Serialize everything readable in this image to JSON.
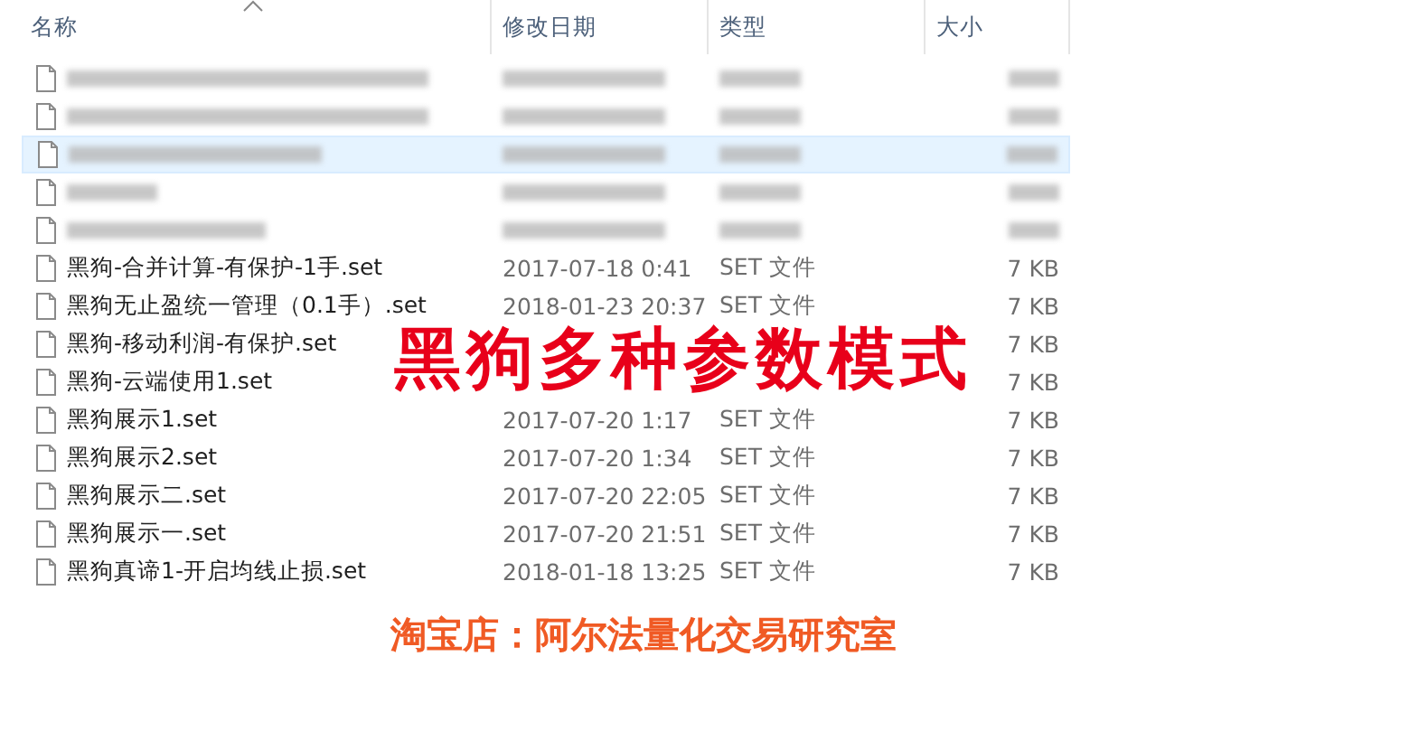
{
  "columns": [
    {
      "label": "名称",
      "sorted": true
    },
    {
      "label": "修改日期",
      "sorted": false
    },
    {
      "label": "类型",
      "sorted": false
    },
    {
      "label": "大小",
      "sorted": false
    }
  ],
  "rows": [
    {
      "kind": "blurred",
      "selected": false
    },
    {
      "kind": "blurred",
      "selected": false
    },
    {
      "kind": "blurred",
      "selected": true
    },
    {
      "kind": "blurred",
      "selected": false
    },
    {
      "kind": "blurred",
      "selected": false
    },
    {
      "kind": "file",
      "selected": false,
      "name": "黑狗-合并计算-有保护-1手.set",
      "date": "2017-07-18 0:41",
      "type": "SET 文件",
      "size": "7 KB"
    },
    {
      "kind": "file",
      "selected": false,
      "name": "黑狗无止盈统一管理（0.1手）.set",
      "date": "2018-01-23 20:37",
      "type": "SET 文件",
      "size": "7 KB"
    },
    {
      "kind": "file",
      "selected": false,
      "name": "黑狗-移动利润-有保护.set",
      "size": "7 KB"
    },
    {
      "kind": "file",
      "selected": false,
      "name": "黑狗-云端使用1.set",
      "size": "7 KB"
    },
    {
      "kind": "file",
      "selected": false,
      "name": "黑狗展示1.set",
      "date": "2017-07-20 1:17",
      "type": "SET 文件",
      "size": "7 KB"
    },
    {
      "kind": "file",
      "selected": false,
      "name": "黑狗展示2.set",
      "date": "2017-07-20 1:34",
      "type": "SET 文件",
      "size": "7 KB"
    },
    {
      "kind": "file",
      "selected": false,
      "name": "黑狗展示二.set",
      "date": "2017-07-20 22:05",
      "type": "SET 文件",
      "size": "7 KB"
    },
    {
      "kind": "file",
      "selected": false,
      "name": "黑狗展示一.set",
      "date": "2017-07-20 21:51",
      "type": "SET 文件",
      "size": "7 KB"
    },
    {
      "kind": "file",
      "selected": false,
      "name": "黑狗真谛1-开启均线止损.set",
      "date": "2018-01-18 13:25",
      "type": "SET 文件",
      "size": "7 KB"
    }
  ],
  "overlay_title": "黑狗多种参数模式",
  "shop_caption": "淘宝店：阿尔法量化交易研究室"
}
